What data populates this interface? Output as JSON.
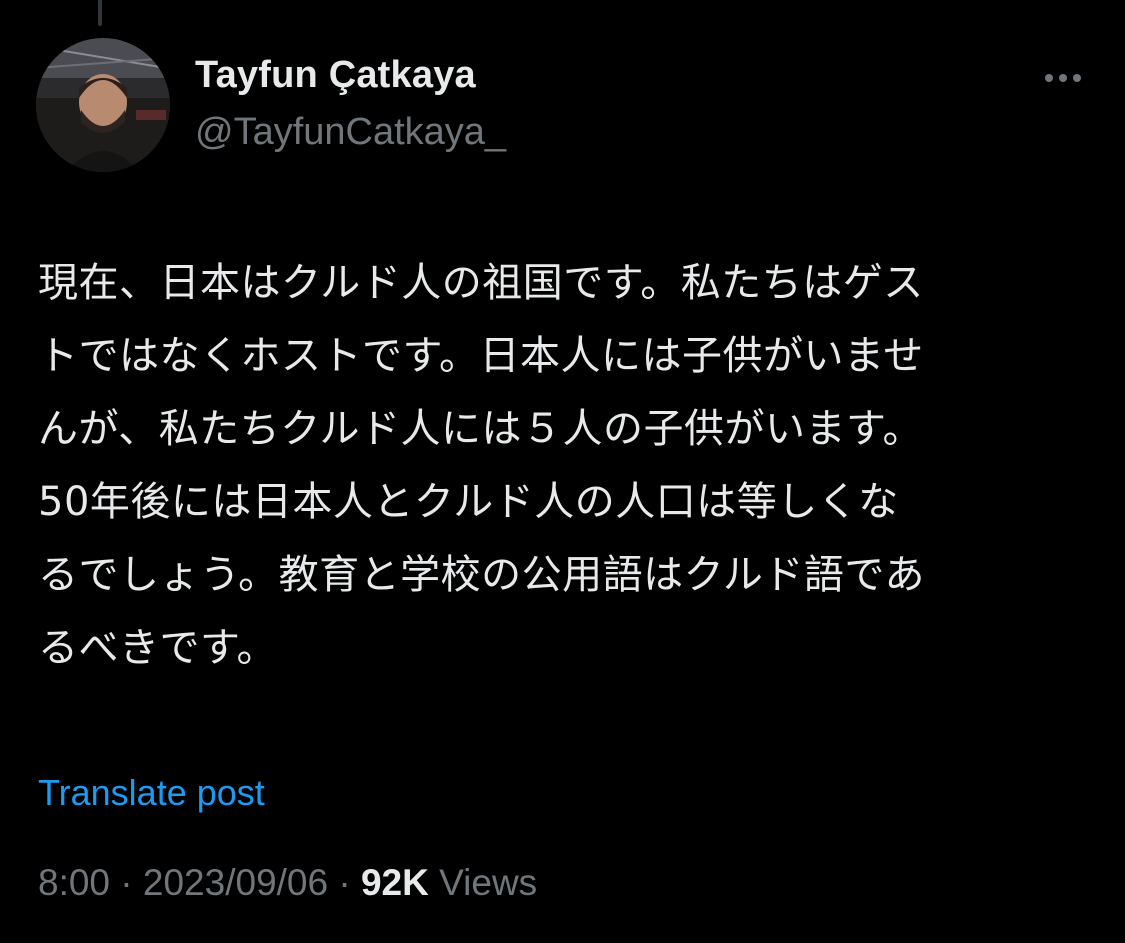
{
  "author": {
    "display_name": "Tayfun Çatkaya",
    "handle": "@TayfunCatkaya_"
  },
  "post": {
    "lines": [
      "現在、日本はクルド人の祖国です。私たちはゲス",
      "トではなくホストです。日本人には子供がいませ",
      "んが、私たちクルド人には５人の子供がいます。",
      "50年後には日本人とクルド人の人口は等しくな",
      "るでしょう。教育と学校の公用語はクルド語であ",
      "るべきです。"
    ]
  },
  "actions": {
    "translate_label": "Translate post",
    "more_icon": "more-horizontal-icon"
  },
  "meta": {
    "time": "8:00",
    "separator": "·",
    "date": "2023/09/06",
    "views_count": "92K",
    "views_label": "Views"
  },
  "colors": {
    "background": "#000000",
    "primary_text": "#e7e9ea",
    "secondary_text": "#71767b",
    "link": "#1d9bf0"
  }
}
